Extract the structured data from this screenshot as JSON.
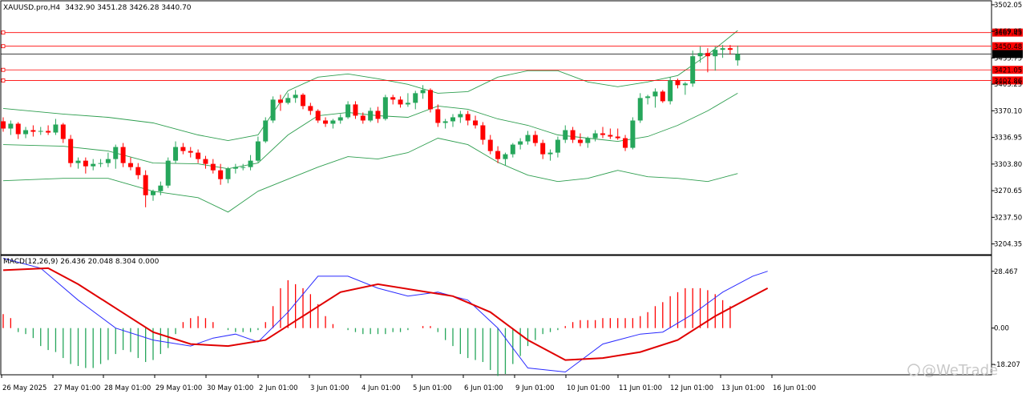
{
  "header": {
    "symbol_info": "XAUUSD.pro,H4",
    "ohlc": "3432.90 3451.28 3426.28 3440.70"
  },
  "indicator": {
    "label": "MACD(12,26,9) 26.436 20.048 8.304 0.000"
  },
  "price_axis": {
    "ticks": [
      "3502.05",
      "3469.05",
      "3435.75",
      "3403.25",
      "3370.10",
      "3336.95",
      "3303.80",
      "3270.65",
      "3237.50",
      "3204.35"
    ]
  },
  "macd_axis": {
    "ticks": [
      "28.467",
      "0.00",
      "-18.207"
    ]
  },
  "time_axis": {
    "ticks": [
      "26 May 2025",
      "27 May 01:00",
      "28 May 01:00",
      "29 May 01:00",
      "30 May 01:00",
      "2 Jun 01:00",
      "3 Jun 01:00",
      "4 Jun 01:00",
      "5 Jun 01:00",
      "6 Jun 01:00",
      "9 Jun 01:00",
      "10 Jun 01:00",
      "11 Jun 01:00",
      "12 Jun 01:00",
      "13 Jun 01:00",
      "16 Jun 01:00"
    ]
  },
  "price_levels": [
    {
      "label": "3467.45",
      "color": "#ff0000"
    },
    {
      "label": "3450.48",
      "color": "#ff0000"
    },
    {
      "label": "3440.70",
      "color": "#000000"
    },
    {
      "label": "3421.05",
      "color": "#ff0000"
    },
    {
      "label": "3407.86",
      "color": "#ff0000"
    }
  ],
  "watermark": "@WeTrade",
  "colors": {
    "bull": "#26a65b",
    "bear": "#ff0000",
    "bands": "#2e9e4f",
    "macd_line": "#2a2aff",
    "signal_line": "#e00000"
  },
  "chart_data": {
    "type": "candlestick",
    "symbol": "XAUUSD.pro",
    "timeframe": "H4",
    "candles": [
      [
        3357,
        3362,
        3344,
        3348
      ],
      [
        3348,
        3358,
        3340,
        3354
      ],
      [
        3354,
        3356,
        3335,
        3341
      ],
      [
        3341,
        3350,
        3336,
        3346
      ],
      [
        3346,
        3352,
        3338,
        3344
      ],
      [
        3344,
        3350,
        3340,
        3345
      ],
      [
        3345,
        3352,
        3340,
        3343
      ],
      [
        3343,
        3360,
        3340,
        3353
      ],
      [
        3353,
        3355,
        3330,
        3335
      ],
      [
        3335,
        3340,
        3300,
        3305
      ],
      [
        3305,
        3312,
        3298,
        3308
      ],
      [
        3308,
        3312,
        3292,
        3301
      ],
      [
        3301,
        3310,
        3296,
        3304
      ],
      [
        3304,
        3310,
        3300,
        3305
      ],
      [
        3305,
        3318,
        3300,
        3310
      ],
      [
        3310,
        3328,
        3298,
        3325
      ],
      [
        3325,
        3330,
        3300,
        3305
      ],
      [
        3305,
        3312,
        3296,
        3300
      ],
      [
        3300,
        3305,
        3285,
        3290
      ],
      [
        3290,
        3296,
        3250,
        3265
      ],
      [
        3265,
        3272,
        3258,
        3270
      ],
      [
        3270,
        3282,
        3265,
        3277
      ],
      [
        3277,
        3312,
        3274,
        3308
      ],
      [
        3308,
        3332,
        3305,
        3325
      ],
      [
        3325,
        3330,
        3316,
        3320
      ],
      [
        3320,
        3325,
        3312,
        3318
      ],
      [
        3318,
        3322,
        3305,
        3310
      ],
      [
        3310,
        3314,
        3298,
        3304
      ],
      [
        3304,
        3310,
        3292,
        3296
      ],
      [
        3296,
        3304,
        3278,
        3285
      ],
      [
        3285,
        3300,
        3280,
        3298
      ],
      [
        3298,
        3304,
        3292,
        3300
      ],
      [
        3300,
        3304,
        3296,
        3300
      ],
      [
        3300,
        3315,
        3296,
        3308
      ],
      [
        3308,
        3338,
        3306,
        3332
      ],
      [
        3332,
        3362,
        3330,
        3358
      ],
      [
        3358,
        3388,
        3355,
        3384
      ],
      [
        3384,
        3390,
        3370,
        3380
      ],
      [
        3380,
        3392,
        3378,
        3386
      ],
      [
        3386,
        3396,
        3380,
        3390
      ],
      [
        3390,
        3392,
        3372,
        3376
      ],
      [
        3376,
        3380,
        3365,
        3370
      ],
      [
        3370,
        3372,
        3355,
        3358
      ],
      [
        3358,
        3362,
        3350,
        3354
      ],
      [
        3354,
        3360,
        3348,
        3358
      ],
      [
        3358,
        3366,
        3354,
        3362
      ],
      [
        3362,
        3382,
        3360,
        3378
      ],
      [
        3378,
        3382,
        3360,
        3364
      ],
      [
        3364,
        3368,
        3354,
        3358
      ],
      [
        3358,
        3374,
        3356,
        3370
      ],
      [
        3370,
        3375,
        3355,
        3360
      ],
      [
        3360,
        3390,
        3358,
        3387
      ],
      [
        3387,
        3390,
        3378,
        3384
      ],
      [
        3384,
        3388,
        3374,
        3378
      ],
      [
        3378,
        3392,
        3375,
        3380
      ],
      [
        3380,
        3395,
        3372,
        3392
      ],
      [
        3392,
        3402,
        3385,
        3396
      ],
      [
        3396,
        3398,
        3368,
        3372
      ],
      [
        3372,
        3378,
        3350,
        3355
      ],
      [
        3355,
        3360,
        3348,
        3357
      ],
      [
        3357,
        3366,
        3350,
        3362
      ],
      [
        3362,
        3370,
        3355,
        3366
      ],
      [
        3366,
        3370,
        3352,
        3358
      ],
      [
        3358,
        3364,
        3348,
        3352
      ],
      [
        3352,
        3356,
        3328,
        3334
      ],
      [
        3334,
        3340,
        3316,
        3320
      ],
      [
        3320,
        3326,
        3305,
        3310
      ],
      [
        3310,
        3318,
        3302,
        3316
      ],
      [
        3316,
        3330,
        3312,
        3328
      ],
      [
        3328,
        3336,
        3322,
        3332
      ],
      [
        3332,
        3345,
        3328,
        3340
      ],
      [
        3340,
        3345,
        3326,
        3330
      ],
      [
        3330,
        3334,
        3310,
        3316
      ],
      [
        3316,
        3322,
        3308,
        3318
      ],
      [
        3318,
        3338,
        3312,
        3334
      ],
      [
        3334,
        3352,
        3330,
        3346
      ],
      [
        3346,
        3350,
        3330,
        3334
      ],
      [
        3334,
        3342,
        3326,
        3330
      ],
      [
        3330,
        3338,
        3324,
        3336
      ],
      [
        3336,
        3346,
        3332,
        3342
      ],
      [
        3342,
        3350,
        3336,
        3340
      ],
      [
        3340,
        3348,
        3335,
        3338
      ],
      [
        3338,
        3348,
        3334,
        3336
      ],
      [
        3336,
        3340,
        3320,
        3324
      ],
      [
        3324,
        3362,
        3322,
        3358
      ],
      [
        3358,
        3392,
        3355,
        3386
      ],
      [
        3386,
        3390,
        3378,
        3388
      ],
      [
        3388,
        3398,
        3374,
        3394
      ],
      [
        3394,
        3396,
        3380,
        3382
      ],
      [
        3382,
        3412,
        3378,
        3408
      ],
      [
        3408,
        3410,
        3398,
        3402
      ],
      [
        3402,
        3406,
        3390,
        3404
      ],
      [
        3404,
        3445,
        3400,
        3438
      ],
      [
        3438,
        3450,
        3430,
        3442
      ],
      [
        3442,
        3448,
        3418,
        3438
      ],
      [
        3438,
        3450,
        3420,
        3446
      ],
      [
        3446,
        3452,
        3436,
        3448
      ],
      [
        3448,
        3452,
        3440,
        3446
      ],
      [
        3432.9,
        3451.28,
        3426.28,
        3440.7
      ]
    ],
    "upper_band": [
      [
        0,
        3373
      ],
      [
        8,
        3366
      ],
      [
        14,
        3362
      ],
      [
        20,
        3355
      ],
      [
        26,
        3340
      ],
      [
        30,
        3333
      ],
      [
        34,
        3340
      ],
      [
        38,
        3395
      ],
      [
        42,
        3412
      ],
      [
        46,
        3416
      ],
      [
        50,
        3410
      ],
      [
        54,
        3403
      ],
      [
        58,
        3392
      ],
      [
        62,
        3394
      ],
      [
        66,
        3412
      ],
      [
        70,
        3420
      ],
      [
        74,
        3420
      ],
      [
        78,
        3406
      ],
      [
        82,
        3400
      ],
      [
        86,
        3406
      ],
      [
        90,
        3414
      ],
      [
        94,
        3440
      ],
      [
        98,
        3470
      ]
    ],
    "middle_band": [
      [
        0,
        3328
      ],
      [
        8,
        3326
      ],
      [
        14,
        3320
      ],
      [
        20,
        3305
      ],
      [
        26,
        3304
      ],
      [
        30,
        3298
      ],
      [
        34,
        3305
      ],
      [
        38,
        3340
      ],
      [
        42,
        3364
      ],
      [
        46,
        3368
      ],
      [
        50,
        3364
      ],
      [
        54,
        3362
      ],
      [
        58,
        3376
      ],
      [
        62,
        3372
      ],
      [
        66,
        3360
      ],
      [
        70,
        3352
      ],
      [
        74,
        3340
      ],
      [
        78,
        3336
      ],
      [
        82,
        3332
      ],
      [
        86,
        3338
      ],
      [
        90,
        3352
      ],
      [
        94,
        3370
      ],
      [
        98,
        3392
      ]
    ],
    "lower_band": [
      [
        0,
        3283
      ],
      [
        8,
        3286
      ],
      [
        14,
        3286
      ],
      [
        20,
        3270
      ],
      [
        26,
        3262
      ],
      [
        30,
        3244
      ],
      [
        34,
        3270
      ],
      [
        38,
        3285
      ],
      [
        42,
        3300
      ],
      [
        46,
        3313
      ],
      [
        50,
        3310
      ],
      [
        54,
        3318
      ],
      [
        58,
        3336
      ],
      [
        62,
        3328
      ],
      [
        66,
        3306
      ],
      [
        70,
        3290
      ],
      [
        74,
        3282
      ],
      [
        78,
        3286
      ],
      [
        82,
        3296
      ],
      [
        86,
        3288
      ],
      [
        90,
        3286
      ],
      [
        94,
        3282
      ],
      [
        98,
        3292
      ]
    ],
    "macd_histogram": [
      7,
      5,
      -2,
      -3,
      -5,
      -9,
      -11,
      -12,
      -15,
      -18,
      -19,
      -20,
      -20,
      -18,
      -16,
      -13,
      -11,
      -12,
      -15,
      -17,
      -16,
      -13,
      -10,
      -3,
      3,
      5,
      6,
      5,
      3,
      0,
      -1,
      -2,
      -2,
      -2,
      -1,
      3,
      11,
      20,
      24,
      22,
      20,
      17,
      12,
      6,
      2,
      0,
      -1,
      -2,
      -3,
      -3,
      -3,
      -3,
      -2,
      -2,
      -1,
      0,
      1,
      1,
      -2,
      -6,
      -9,
      -13,
      -15,
      -16,
      -17,
      -21,
      -24,
      -23,
      -18,
      -14,
      -9,
      -6,
      -3,
      -2,
      -1,
      1,
      3,
      4,
      4,
      4,
      5,
      5,
      5,
      5,
      5,
      6,
      8,
      11,
      13,
      16,
      18,
      20,
      20,
      20,
      19,
      17,
      14,
      11
    ],
    "macd_line": [
      [
        0,
        35
      ],
      [
        5,
        30
      ],
      [
        10,
        14
      ],
      [
        15,
        0
      ],
      [
        20,
        -6
      ],
      [
        25,
        -9
      ],
      [
        28,
        -5
      ],
      [
        31,
        -3
      ],
      [
        34,
        -7
      ],
      [
        38,
        8
      ],
      [
        42,
        26
      ],
      [
        46,
        26
      ],
      [
        50,
        20
      ],
      [
        54,
        16
      ],
      [
        58,
        18
      ],
      [
        62,
        14
      ],
      [
        66,
        0
      ],
      [
        70,
        -20
      ],
      [
        75,
        -22
      ],
      [
        80,
        -8
      ],
      [
        85,
        -3
      ],
      [
        88,
        -2
      ],
      [
        92,
        7
      ],
      [
        96,
        18
      ],
      [
        100,
        26
      ],
      [
        102,
        28.5
      ]
    ],
    "signal_line": [
      [
        0,
        29
      ],
      [
        6,
        30
      ],
      [
        10,
        22
      ],
      [
        15,
        10
      ],
      [
        20,
        -2
      ],
      [
        25,
        -8
      ],
      [
        30,
        -9
      ],
      [
        35,
        -6
      ],
      [
        40,
        6
      ],
      [
        45,
        18
      ],
      [
        50,
        22
      ],
      [
        55,
        19
      ],
      [
        60,
        16
      ],
      [
        65,
        8
      ],
      [
        70,
        -6
      ],
      [
        75,
        -16
      ],
      [
        80,
        -15
      ],
      [
        85,
        -12
      ],
      [
        90,
        -6
      ],
      [
        95,
        6
      ],
      [
        100,
        16
      ],
      [
        102,
        20
      ]
    ]
  }
}
